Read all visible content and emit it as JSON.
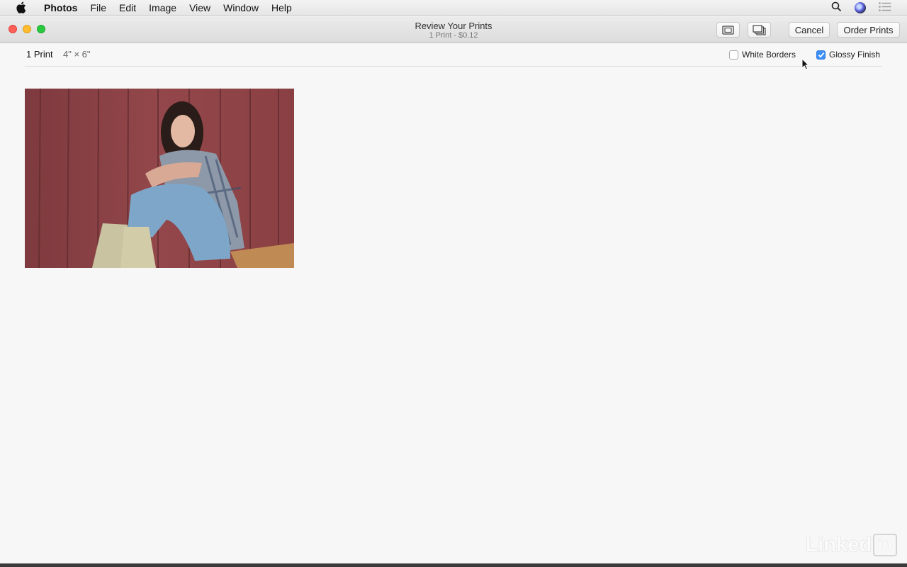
{
  "menubar": {
    "apple_icon": "apple-logo-icon",
    "items": [
      "Photos",
      "File",
      "Edit",
      "Image",
      "View",
      "Window",
      "Help"
    ],
    "right_icons": [
      "search-icon",
      "siri-icon",
      "notification-center-icon"
    ]
  },
  "window": {
    "title": "Review Your Prints",
    "subtitle": "1 Print - $0.12",
    "toolbar": {
      "single_view_icon": "single-photo-view-icon",
      "stack_view_icon": "stacked-photos-view-icon",
      "cancel_label": "Cancel",
      "order_label": "Order Prints"
    }
  },
  "infobar": {
    "count": "1 Print",
    "size": "4\" × 6\"",
    "white_borders": {
      "label": "White Borders",
      "checked": false
    },
    "glossy_finish": {
      "label": "Glossy Finish",
      "checked": true
    }
  },
  "watermark": {
    "text": "Linked",
    "box": "in"
  },
  "colors": {
    "accent": "#3d8ef5",
    "close": "#fd5f57",
    "minimize": "#febc2e",
    "zoom": "#28c840"
  }
}
